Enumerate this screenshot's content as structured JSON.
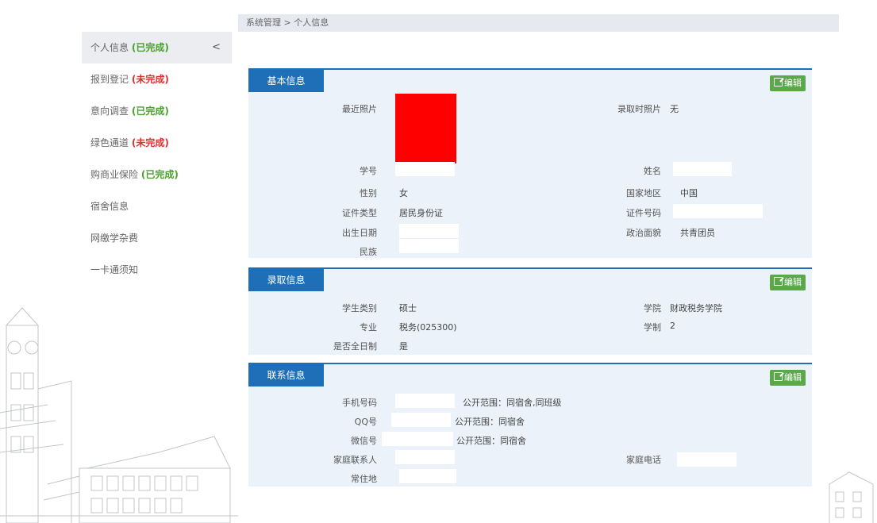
{
  "breadcrumb": "系统管理 > 个人信息",
  "sidebar": {
    "items": [
      {
        "label": "个人信息",
        "status": "(已完成)"
      },
      {
        "label": "报到登记",
        "status": "(未完成)"
      },
      {
        "label": "意向调查",
        "status": "(已完成)"
      },
      {
        "label": "绿色通道",
        "status": "(未完成)"
      },
      {
        "label": "购商业保险",
        "status": "(已完成)"
      },
      {
        "label": "宿舍信息",
        "status": ""
      },
      {
        "label": "网缴学杂费",
        "status": ""
      },
      {
        "label": "一卡通须知",
        "status": ""
      }
    ],
    "collapse_glyph": "<"
  },
  "edit_label": "编辑",
  "basic": {
    "title": "基本信息",
    "photo_label": "最近照片",
    "admission_photo_label": "录取时照片",
    "admission_photo_value": "无",
    "student_id_label": "学号",
    "name_label": "姓名",
    "gender_label": "性别",
    "gender_value": "女",
    "country_label": "国家地区",
    "country_value": "中国",
    "idtype_label": "证件类型",
    "idtype_value": "居民身份证",
    "idno_label": "证件号码",
    "birth_label": "出生日期",
    "politics_label": "政治面貌",
    "politics_value": "共青团员",
    "ethnic_label": "民族"
  },
  "admission": {
    "title": "录取信息",
    "category_label": "学生类别",
    "category_value": "硕士",
    "college_label": "学院",
    "college_value": "财政税务学院",
    "major_label": "专业",
    "major_value": "税务(025300)",
    "duration_label": "学制",
    "duration_value": "2",
    "fulltime_label": "是否全日制",
    "fulltime_value": "是"
  },
  "contact": {
    "title": "联系信息",
    "phone_label": "手机号码",
    "phone_scope": "公开范围：同宿舍,同班级",
    "qq_label": "QQ号",
    "qq_scope": "公开范围：同宿舍",
    "wechat_label": "微信号",
    "wechat_scope": "公开范围：同宿舍",
    "family_contact_label": "家庭联系人",
    "family_phone_label": "家庭电话",
    "residence_label": "常住地"
  },
  "colors": {
    "accent_blue": "#1e6fb8",
    "edit_green": "#5aa84a",
    "done_green": "#4aa02c",
    "todo_red": "#d9312b",
    "photo_red": "#ff0000"
  }
}
